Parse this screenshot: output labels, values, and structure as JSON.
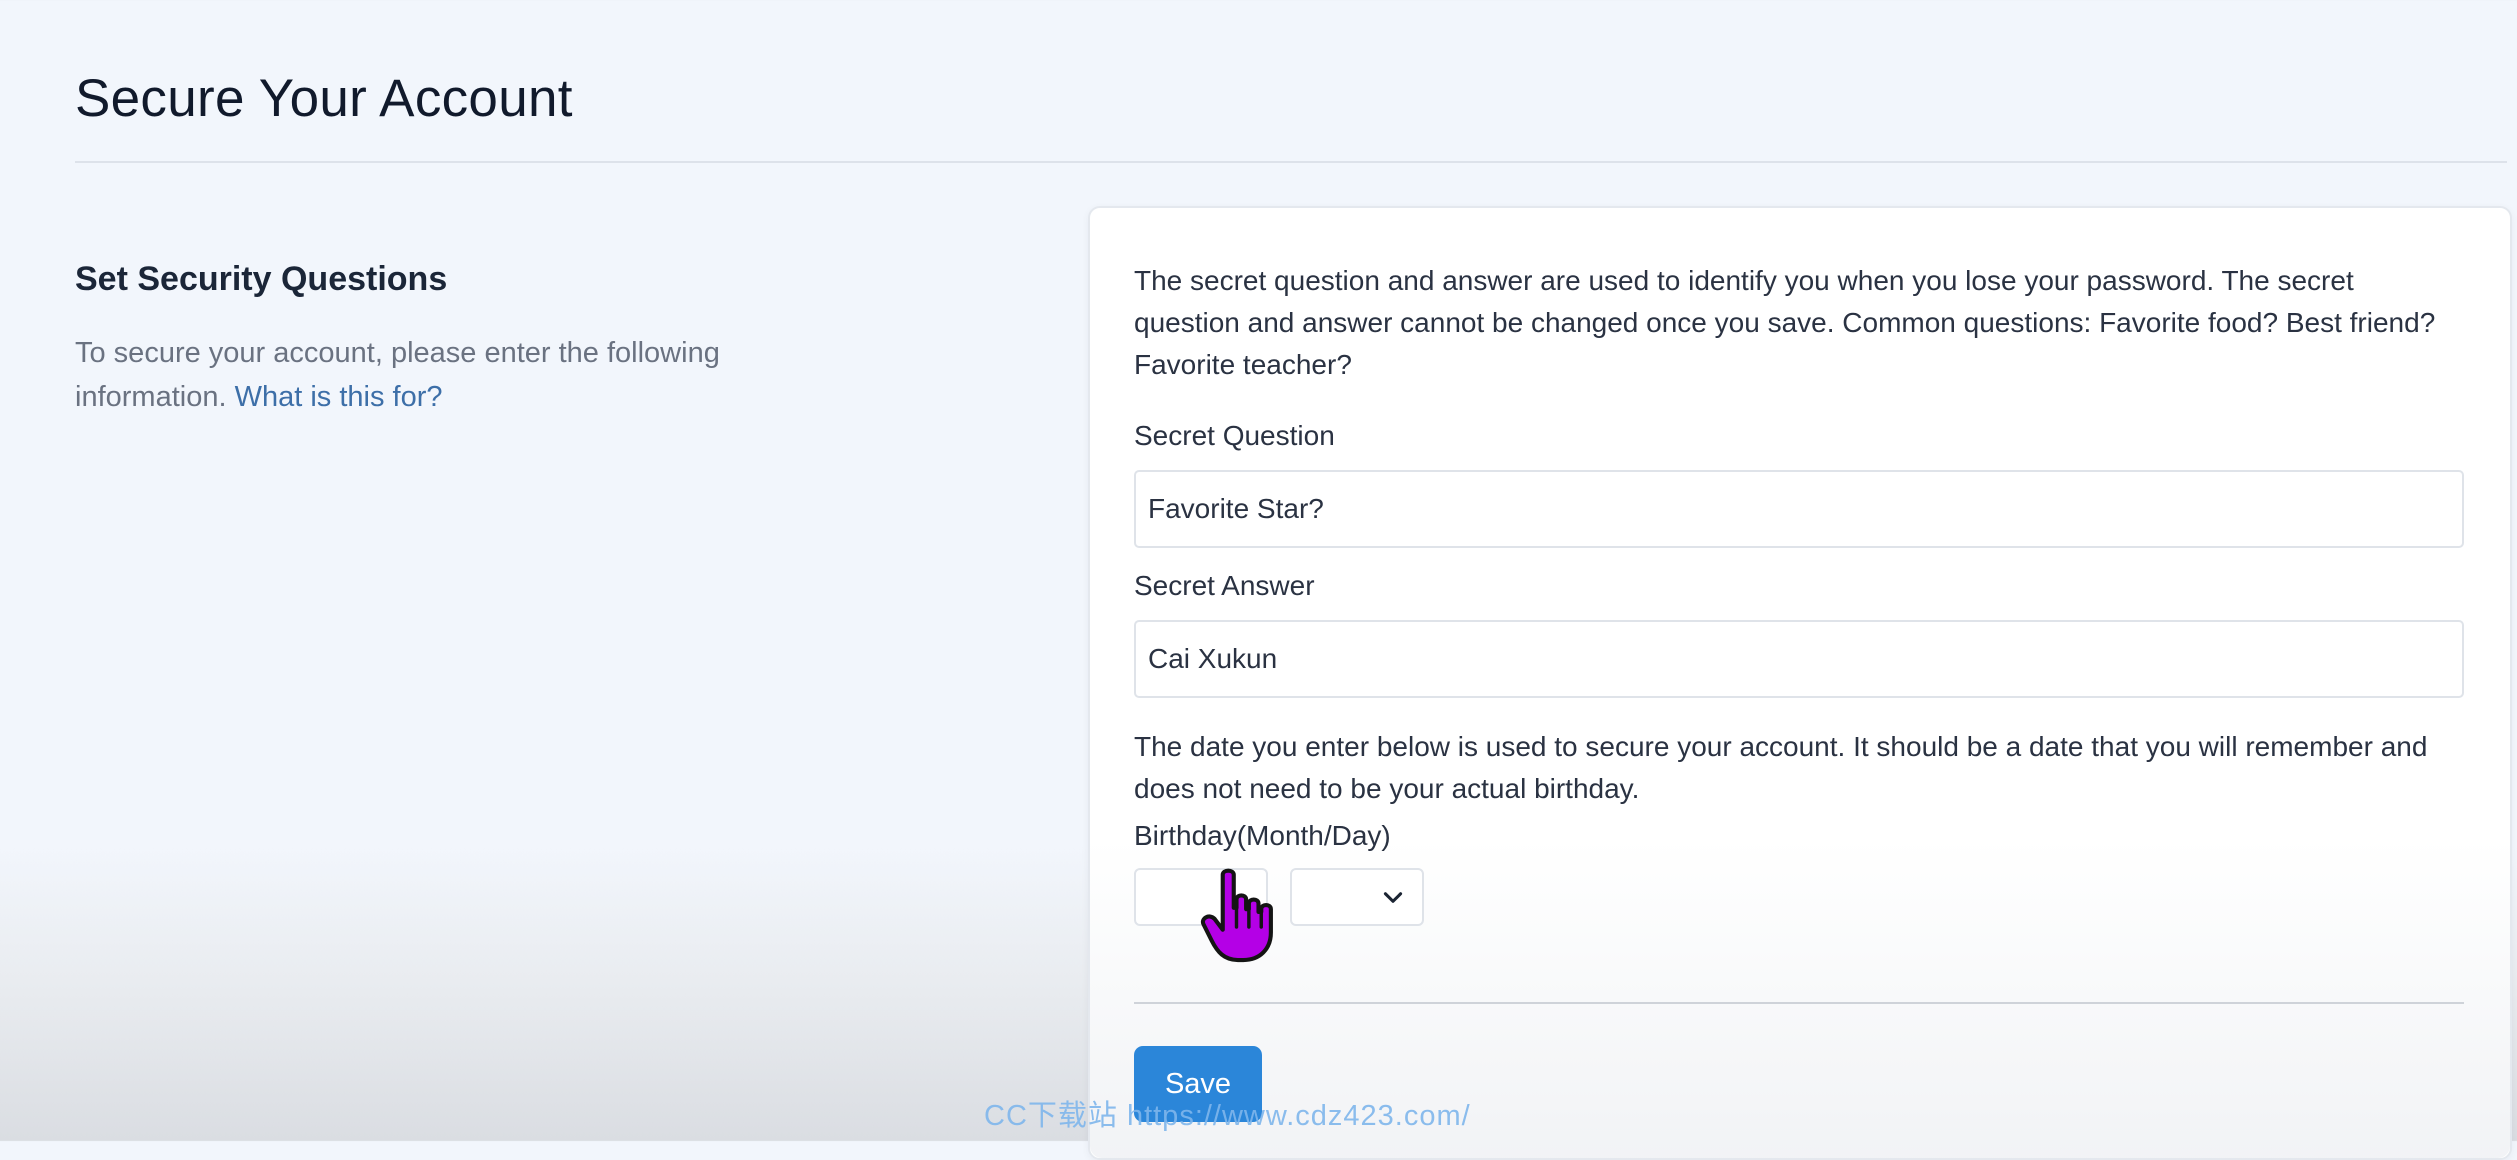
{
  "page": {
    "title": "Secure Your Account"
  },
  "left": {
    "heading": "Set Security Questions",
    "description": "To secure your account, please enter the following information. ",
    "help_link": "What is this for?"
  },
  "form": {
    "intro": "The secret question and answer are used to identify you when you lose your password. The secret question and answer cannot be changed once you save. Common questions: Favorite food? Best friend? Favorite teacher?",
    "question_label": "Secret Question",
    "question_value": "Favorite Star?",
    "answer_label": "Secret Answer",
    "answer_value": "Cai Xukun",
    "date_info": "The date you enter below is used to secure your account. It should be a date that you will remember and does not need to be your actual birthday.",
    "birthday_label": "Birthday(Month/Day)",
    "month_value": "",
    "day_value": "",
    "save_label": "Save"
  },
  "watermark": "CC下载站  https://www.cdz423.com/",
  "colors": {
    "accent": "#2b86d9",
    "link": "#3d6fa8",
    "cursor": "#b400e6"
  },
  "icons": {
    "chevron": "chevron-down-icon",
    "cursor": "hand-pointer-icon"
  }
}
